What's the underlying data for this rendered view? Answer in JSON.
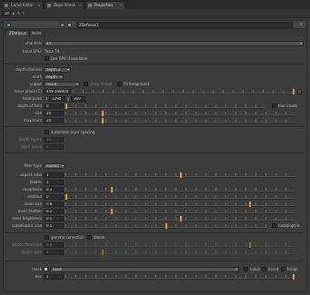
{
  "tabs": [
    {
      "label": "Curve Editor",
      "active": false
    },
    {
      "label": "Dope Sheet",
      "active": false
    },
    {
      "label": "Properties",
      "active": true
    }
  ],
  "toolbar": {
    "count": "30",
    "icons": [
      "tool-icon",
      "eraser-icon",
      "pin-icon"
    ]
  },
  "panel": {
    "node_name": "ZDefocus1",
    "swatch_colors": [
      "#6b8fb8",
      "#8a8a8a",
      "#c9a060"
    ],
    "subtabs": [
      "ZDefocus",
      "Node"
    ]
  },
  "rows": {
    "channels": {
      "label": "channels",
      "value": "all"
    },
    "local_gpu": {
      "label": "Local GPU:",
      "value": "Tesla T4"
    },
    "use_gpu": {
      "label": "Use GPU if available"
    },
    "depth_channel": {
      "label": "depth channel",
      "value": "depth.Z"
    },
    "math": {
      "label": "math",
      "value": "depth"
    },
    "output": {
      "label": "output",
      "value": "result",
      "show_image": "show image",
      "fill_fg": "fill foreground"
    },
    "focus_plane": {
      "label": "focus plane (C)",
      "value": "449.168000"
    },
    "focal_point": {
      "label": "focal point",
      "x": "1290",
      "y": "360"
    },
    "depth_of_field": {
      "label": "depth of field",
      "value": "0",
      "blur_inside": "blur inside"
    },
    "size": {
      "label": "size",
      "value": "20"
    },
    "maximum": {
      "label": "maximum",
      "value": "20"
    },
    "auto_layer": {
      "label": "automatic layer spacing"
    },
    "depth_layers": {
      "label": "depth layers",
      "value": "10"
    },
    "layer_curve": {
      "label": "layer curve",
      "value": "0"
    },
    "filter_type": {
      "label": "filter type",
      "value": "bladed"
    },
    "aspect_ratio": {
      "label": "aspect ratio",
      "value": "1"
    },
    "blades": {
      "label": "blades",
      "value": "5"
    },
    "roundness": {
      "label": "roundness",
      "value": "0.2"
    },
    "rotation": {
      "label": "rotation",
      "value": "0"
    },
    "inner_size": {
      "label": "inner size",
      "value": "0.8"
    },
    "inner_feather": {
      "label": "inner feather",
      "value": "0.2"
    },
    "inner_brightness": {
      "label": "inner brightness",
      "value": "0.5"
    },
    "catadioptric_size": {
      "label": "catadioptric size",
      "value": "0.5",
      "catadioptric": "catadioptric"
    },
    "gamma_correction": {
      "label": "gamma correction",
      "bloom": "bloom"
    },
    "bloom_threshold": {
      "label": "bloom threshold",
      "value": "0.8"
    },
    "bloom_gain": {
      "label": "bloom gain",
      "value": "2"
    },
    "mask": {
      "label": "mask",
      "value": "none",
      "inject": "inject",
      "invert": "invert",
      "fringe": "fringe"
    },
    "mix": {
      "label": "mix",
      "value": "1"
    }
  },
  "colors": {
    "accent": "#d8a040",
    "panel": "#3c3c3c",
    "field": "#2d2d2d"
  }
}
